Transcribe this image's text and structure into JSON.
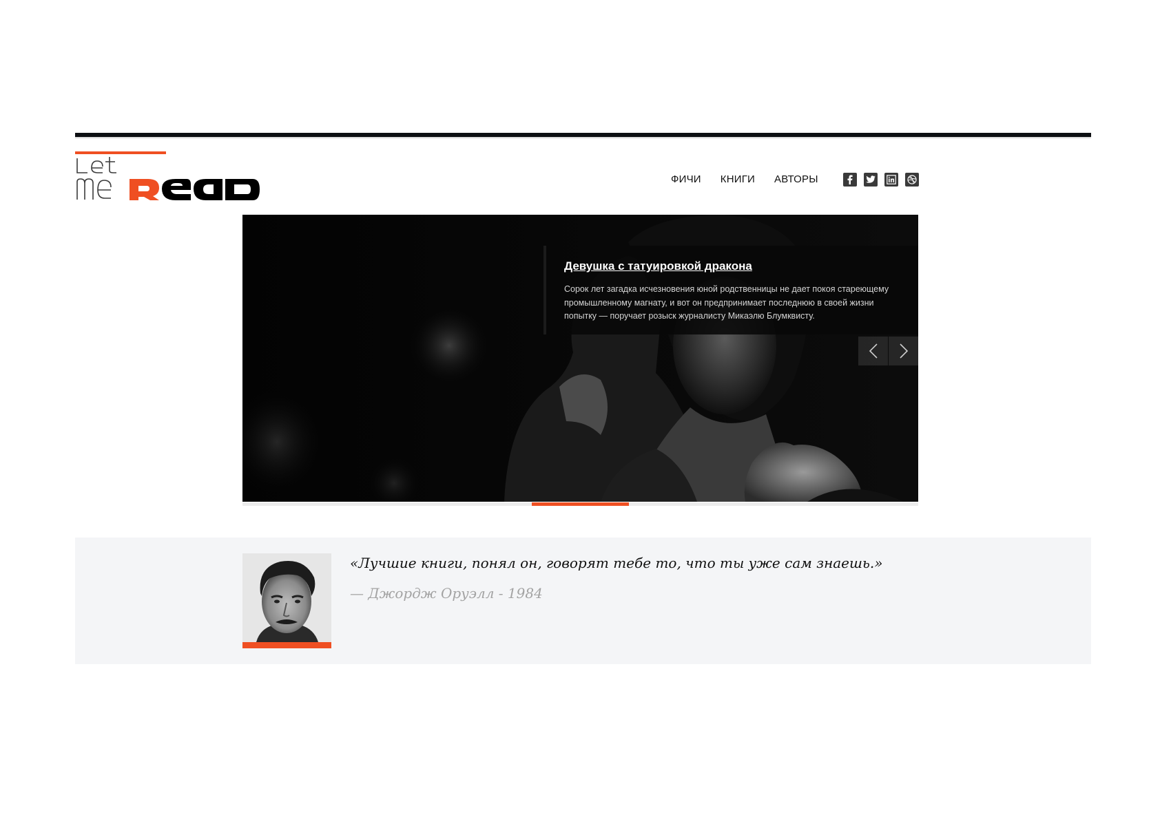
{
  "brand": {
    "logo_alt": "LetmeRead",
    "accent_color": "#ef4f22"
  },
  "nav": {
    "items": [
      "ФИЧИ",
      "КНИГИ",
      "АВТОРЫ"
    ]
  },
  "social": {
    "icons": [
      "facebook-icon",
      "twitter-icon",
      "linkedin-icon",
      "dribbble-icon"
    ]
  },
  "slider": {
    "title": "Девушка с татуировкой дракона",
    "description": "Сорок лет загадка исчезновения юной родственницы не дает покоя стареющему промышленному магнату, и вот он предпринимает последнюю в своей жизни попытку — поручает розыск журналисту Микаэлю Блумквисту.",
    "prev_icon": "chevron-left-icon",
    "next_icon": "chevron-right-icon"
  },
  "quote": {
    "text": "«Лучшие книги, понял он, говорят тебе то, что ты уже сам знаешь.»",
    "author": "— Джордж Оруэлл - 1984"
  }
}
